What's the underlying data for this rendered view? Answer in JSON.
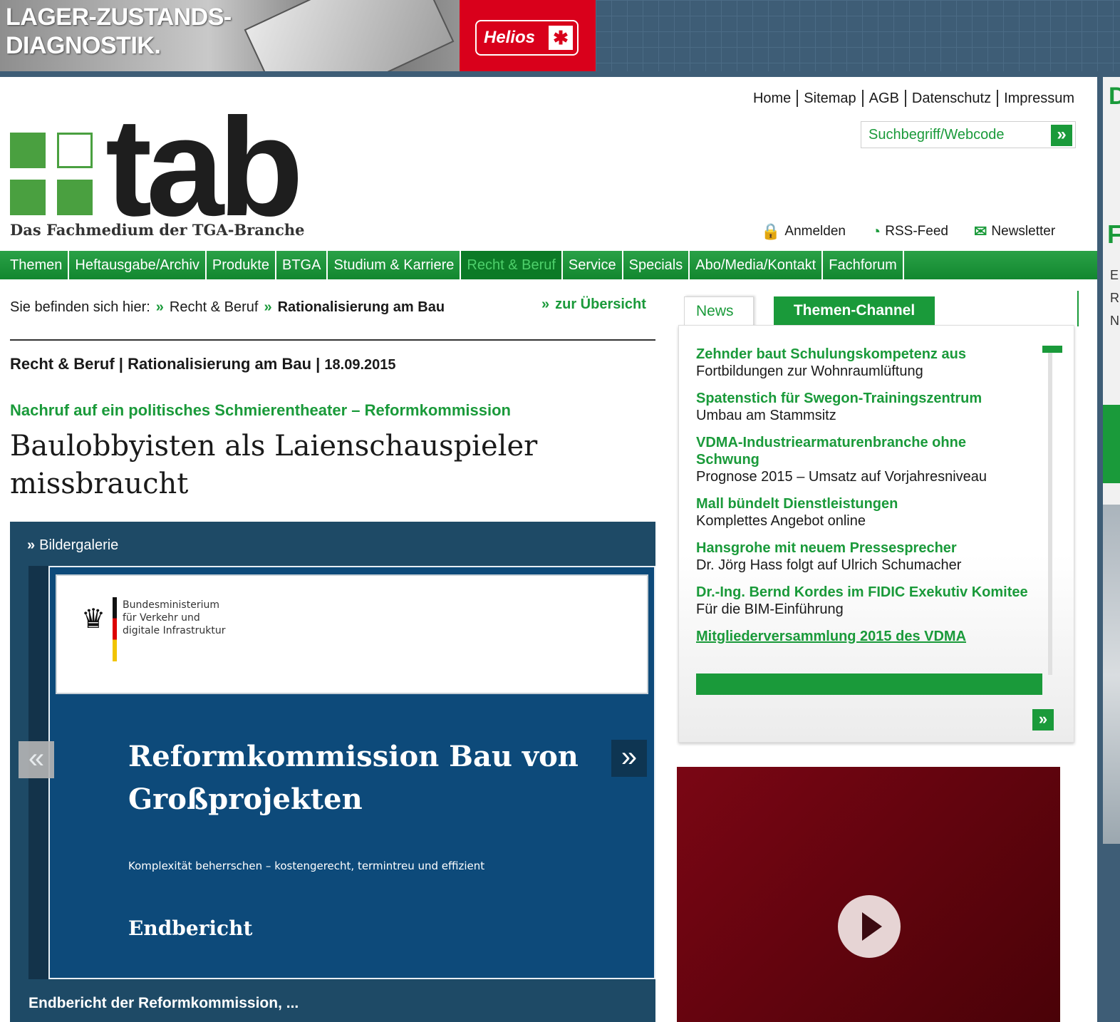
{
  "ad_banner": {
    "text": "LAGER-ZUSTANDS-\nDIAGNOSTIK.",
    "brand": "Helios",
    "brand_icon": "fan-icon"
  },
  "side_ad": {
    "line1": "D",
    "line2": "F",
    "line3": "E\nR\nN"
  },
  "meta_nav": [
    "Home",
    "Sitemap",
    "AGB",
    "Datenschutz",
    "Impressum"
  ],
  "search": {
    "placeholder": "Suchbegriff/Webcode",
    "button": "»"
  },
  "logo": {
    "word": "tab",
    "tagline": "Das Fachmedium der TGA-Branche"
  },
  "util_links": {
    "login": {
      "label": "Anmelden",
      "icon": "lock-icon",
      "glyph": "🔒"
    },
    "rss": {
      "label": "RSS-Feed",
      "icon": "rss-icon",
      "glyph": "◔"
    },
    "newsletter": {
      "label": "Newsletter",
      "icon": "envelope-icon",
      "glyph": "✉"
    }
  },
  "main_nav": [
    {
      "label": "Themen",
      "active": false
    },
    {
      "label": "Heftausgabe/Archiv",
      "active": false
    },
    {
      "label": "Produkte",
      "active": false
    },
    {
      "label": "BTGA",
      "active": false
    },
    {
      "label": "Studium & Karriere",
      "active": false
    },
    {
      "label": "Recht & Beruf",
      "active": true
    },
    {
      "label": "Service",
      "active": false
    },
    {
      "label": "Specials",
      "active": false
    },
    {
      "label": "Abo/Media/Kontakt",
      "active": false
    },
    {
      "label": "Fachforum",
      "active": false
    }
  ],
  "breadcrumb": {
    "prefix": "Sie befinden sich hier:",
    "sep": "»",
    "level1": "Recht & Beruf",
    "level2": "Rationalisierung am Bau",
    "back_link": "zur Übersicht"
  },
  "article": {
    "meta": "Recht & Beruf | Rationalisierung am Bau |",
    "date": "18.09.2015",
    "kicker": "Nachruf auf ein politisches Schmierentheater – Reformkommission",
    "headline": "Baulobbyisten als Laienschauspieler missbraucht"
  },
  "gallery": {
    "title": "Bildergalerie",
    "title_icon": "»",
    "slide": {
      "ministry": "Bundesministerium\nfür Verkehr und\ndigitale Infrastruktur",
      "title": "Reformkommission Bau von Großprojekten",
      "subtitle": "Komplexität beherrschen – kostengerecht, termintreu und effizient",
      "footer": "Endbericht"
    },
    "prev": "«",
    "next": "»",
    "caption": "Endbericht der Reformkommission, ..."
  },
  "news": {
    "tabs": {
      "news": "News",
      "themen": "Themen-Channel"
    },
    "items": [
      {
        "title": "Zehnder baut Schulungskompetenz aus",
        "sub": "Fortbildungen zur Wohnraumlüftung"
      },
      {
        "title": "Spatenstich für Swegon-Trainingszentrum",
        "sub": "Umbau am Stammsitz"
      },
      {
        "title": "VDMA-Industriearmaturenbranche ohne Schwung",
        "sub": "Prognose 2015 – Umsatz auf Vorjahresniveau"
      },
      {
        "title": "Mall bündelt Dienstleistungen",
        "sub": "Komplettes Angebot online"
      },
      {
        "title": "Hansgrohe mit neuem Pressesprecher",
        "sub": "Dr. Jörg Hass folgt auf Ulrich Schumacher"
      },
      {
        "title": "Dr.-Ing. Bernd Kordes im FIDIC Exekutiv Komitee",
        "sub": "Für die BIM-Einführung"
      },
      {
        "title": "Mitgliederversammlung 2015 des VDMA",
        "sub": ""
      }
    ],
    "more": "»"
  },
  "video": {
    "play_icon": "play-icon"
  },
  "colors": {
    "brand_green": "#1a9a3a",
    "nav_active_text": "#4ed06b",
    "gallery_bg": "#1e4a66",
    "video_bg": "#7a0614"
  }
}
